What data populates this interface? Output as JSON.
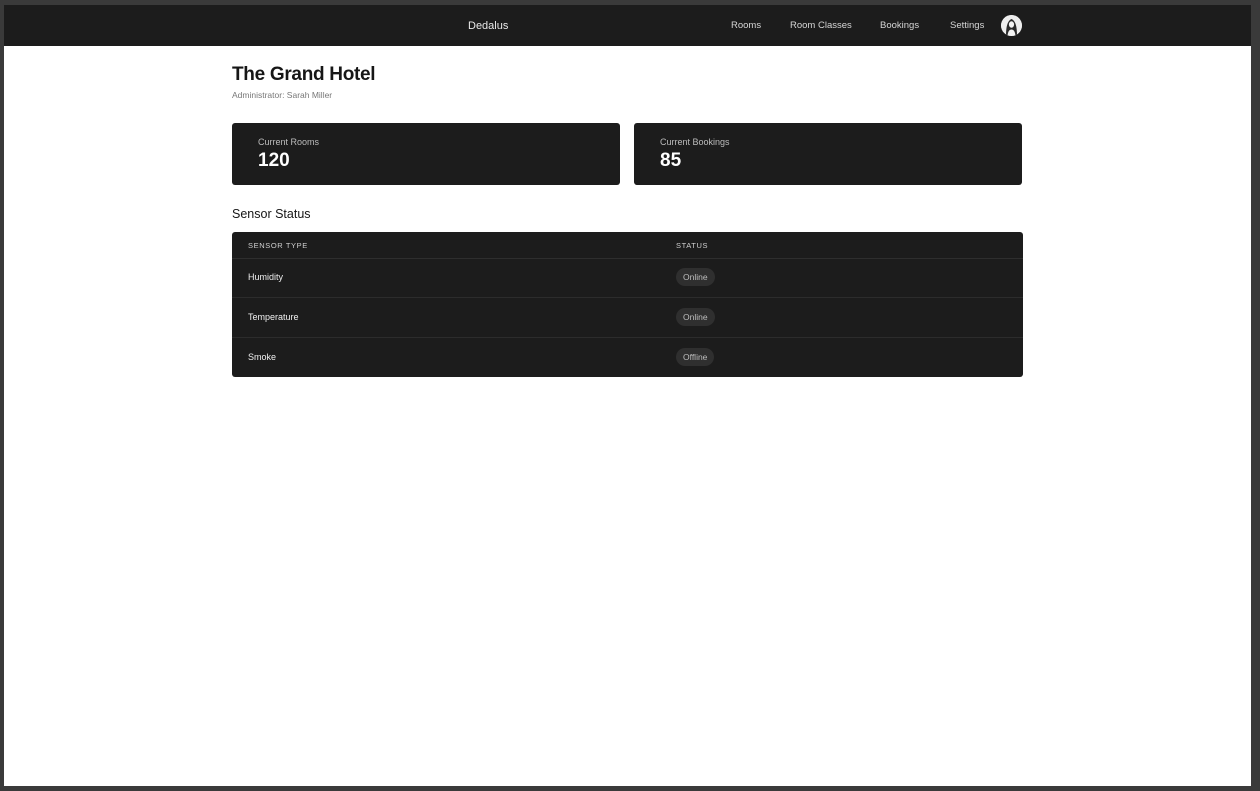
{
  "header": {
    "brand": "Dedalus",
    "nav": [
      "Rooms",
      "Room Classes",
      "Bookings",
      "Settings"
    ],
    "avatar_icon": "user-avatar-icon"
  },
  "hotel": {
    "title": "The Grand Hotel",
    "administrator": "Administrator: Sarah Miller"
  },
  "stats": [
    {
      "label": "Current Rooms",
      "value": "120"
    },
    {
      "label": "Current Bookings",
      "value": "85"
    }
  ],
  "sensors": {
    "title": "Sensor Status",
    "columns": [
      "SENSOR TYPE",
      "STATUS"
    ],
    "rows": [
      {
        "type": "Humidity",
        "status": "Online"
      },
      {
        "type": "Temperature",
        "status": "Online"
      },
      {
        "type": "Smoke",
        "status": "Offline"
      }
    ]
  },
  "colors": {
    "header_bg": "#1c1c1c",
    "card_bg": "#1c1c1c",
    "page_bg": "#ffffff",
    "badge_bg": "#2f2f2f"
  }
}
